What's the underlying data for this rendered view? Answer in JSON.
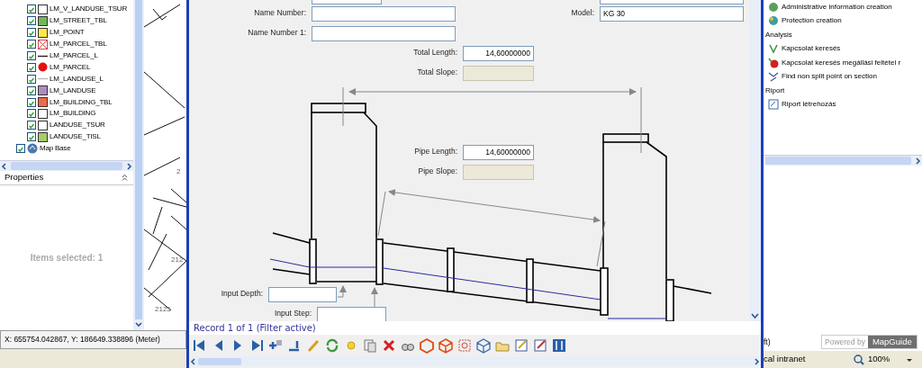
{
  "layer_tree": {
    "layers": [
      {
        "label": "LM_V_LANDUSE_TSUR",
        "checked": true,
        "kind": "box",
        "color": "#ffffff"
      },
      {
        "label": "LM_STREET_TBL",
        "checked": true,
        "kind": "box",
        "color": "#6dbb5a"
      },
      {
        "label": "LM_POINT",
        "checked": true,
        "kind": "box",
        "color": "#ffe94a"
      },
      {
        "label": "LM_PARCEL_TBL",
        "checked": true,
        "kind": "cross",
        "color": "#d04848"
      },
      {
        "label": "LM_PARCEL_L",
        "checked": true,
        "kind": "line",
        "color": "#222222"
      },
      {
        "label": "LM_PARCEL",
        "checked": true,
        "kind": "dot",
        "color": "#e81010"
      },
      {
        "label": "LM_LANDUSE_L",
        "checked": true,
        "kind": "line",
        "color": "#b8b8b8"
      },
      {
        "label": "LM_LANDUSE",
        "checked": true,
        "kind": "box",
        "color": "#b08cc0"
      },
      {
        "label": "LM_BUILDING_TBL",
        "checked": true,
        "kind": "box",
        "color": "#f06a4a"
      },
      {
        "label": "LM_BUILDING",
        "checked": true,
        "kind": "box",
        "color": "#fcfcfc"
      },
      {
        "label": "LANDUSE_TSUR",
        "checked": true,
        "kind": "box",
        "color": "#ffffff"
      },
      {
        "label": "LANDUSE_TISL",
        "checked": true,
        "kind": "box",
        "color": "#a8cc6a"
      }
    ],
    "root": {
      "label": "Map Base",
      "checked": true
    }
  },
  "properties": {
    "title": "Properties",
    "message": "Items selected: 1"
  },
  "coordinates": "X: 655754.042867, Y: 186649.338896 (Meter)",
  "map_labels": [
    "2",
    "212",
    "2125"
  ],
  "form": {
    "fields": [
      {
        "label": "Name Number:",
        "disabled": false
      },
      {
        "label": "Name Number 1:",
        "disabled": false
      },
      {
        "label": "Model:",
        "value": "KG 30",
        "disabled": false
      },
      {
        "label": "Total Length:",
        "value": "14,60000000",
        "disabled": false
      },
      {
        "label": "Total Slope:",
        "disabled": true
      },
      {
        "label": "Pipe Length:",
        "value": "14,60000000",
        "disabled": false
      },
      {
        "label": "Pipe Slope:",
        "disabled": true
      },
      {
        "label": "Input Depth:",
        "disabled": false
      },
      {
        "label": "Input Step:",
        "disabled": false
      }
    ],
    "record_status": "Record 1 of 1 (Filter active)"
  },
  "tasks": [
    {
      "kind": "task",
      "label": "Administrative information creation"
    },
    {
      "kind": "task",
      "label": "Protection creation"
    },
    {
      "kind": "heading",
      "label": "Analysis"
    },
    {
      "kind": "task",
      "label": "Kapcsolat keresés"
    },
    {
      "kind": "task",
      "label": "Kapcsolat keresés megállási feltétel r"
    },
    {
      "kind": "task",
      "label": "Find non split point on section"
    },
    {
      "kind": "heading",
      "label": "Riport"
    },
    {
      "kind": "task",
      "label": "Riport létrehozás"
    }
  ],
  "footer": {
    "units": "ft)",
    "powered_by": "Powered by",
    "brand": "MapGuide"
  },
  "browser_status": {
    "zone": "cal intranet",
    "zoom": "100%"
  }
}
